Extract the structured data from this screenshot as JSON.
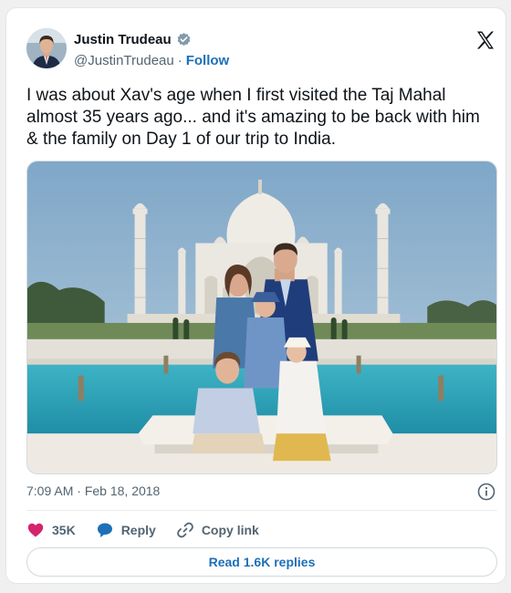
{
  "author": {
    "name": "Justin Trudeau",
    "handle": "@JustinTrudeau",
    "separator": "·",
    "follow_label": "Follow",
    "verified_icon": "verified-badge-icon"
  },
  "brand_icon": "x-logo-icon",
  "tweet": {
    "text": "I was about Xav's age when I first visited the Taj Mahal almost 35 years ago... and it's amazing to be back with him & the family on Day 1 of our trip to India."
  },
  "photo": {
    "subject": "taj-mahal-family-photo"
  },
  "meta": {
    "time": "7:09 AM",
    "separator": "·",
    "date": "Feb 18, 2018",
    "info_icon": "info-icon"
  },
  "actions": {
    "like_count": "35K",
    "reply_label": "Reply",
    "copy_link_label": "Copy link"
  },
  "replies_button": {
    "label": "Read 1.6K replies"
  },
  "colors": {
    "accent": "#1d6fb8",
    "like": "#d3246e",
    "reply": "#1d6fb8",
    "text_secondary": "#536471"
  }
}
